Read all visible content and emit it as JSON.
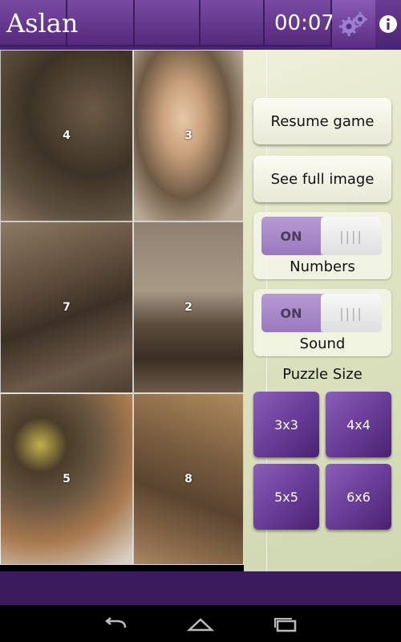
{
  "header": {
    "title": "Aslan",
    "timer": "00:07"
  },
  "puzzle": {
    "tiles": [
      {
        "number": "4"
      },
      {
        "number": "3"
      },
      {
        "number": "7"
      },
      {
        "number": "2"
      },
      {
        "number": "5"
      },
      {
        "number": "8"
      }
    ]
  },
  "panel": {
    "resume_label": "Resume game",
    "full_image_label": "See full image",
    "numbers_toggle": {
      "state": "ON",
      "label": "Numbers"
    },
    "sound_toggle": {
      "state": "ON",
      "label": "Sound"
    },
    "puzzle_size_label": "Puzzle Size",
    "sizes": [
      "3x3",
      "4x4",
      "5x5",
      "6x6"
    ]
  },
  "colors": {
    "accent": "#5a2d82",
    "panel_bg": "#dfe4c2"
  },
  "icons": [
    "gear-icon",
    "info-icon",
    "back-icon",
    "home-icon",
    "recent-apps-icon"
  ]
}
